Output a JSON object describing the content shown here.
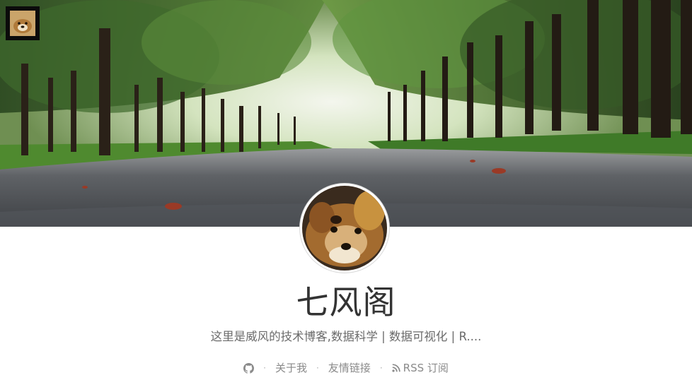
{
  "hero": {
    "image": "tree-lined-road-photo",
    "logo_icon": "dog-avatar-icon"
  },
  "profile": {
    "avatar": "dog-avatar-photo",
    "title": "七风阁",
    "description": "这里是威风的技术博客,数据科学 | 数据可视化 | R...."
  },
  "nav": {
    "github_icon": "github-icon",
    "separator": "·",
    "about_label": "关于我",
    "links_label": "友情链接",
    "rss_icon": "rss-icon",
    "rss_label": "RSS 订阅"
  },
  "colors": {
    "title": "#333333",
    "description": "#6b6b6b",
    "nav": "#8a8a8a"
  }
}
